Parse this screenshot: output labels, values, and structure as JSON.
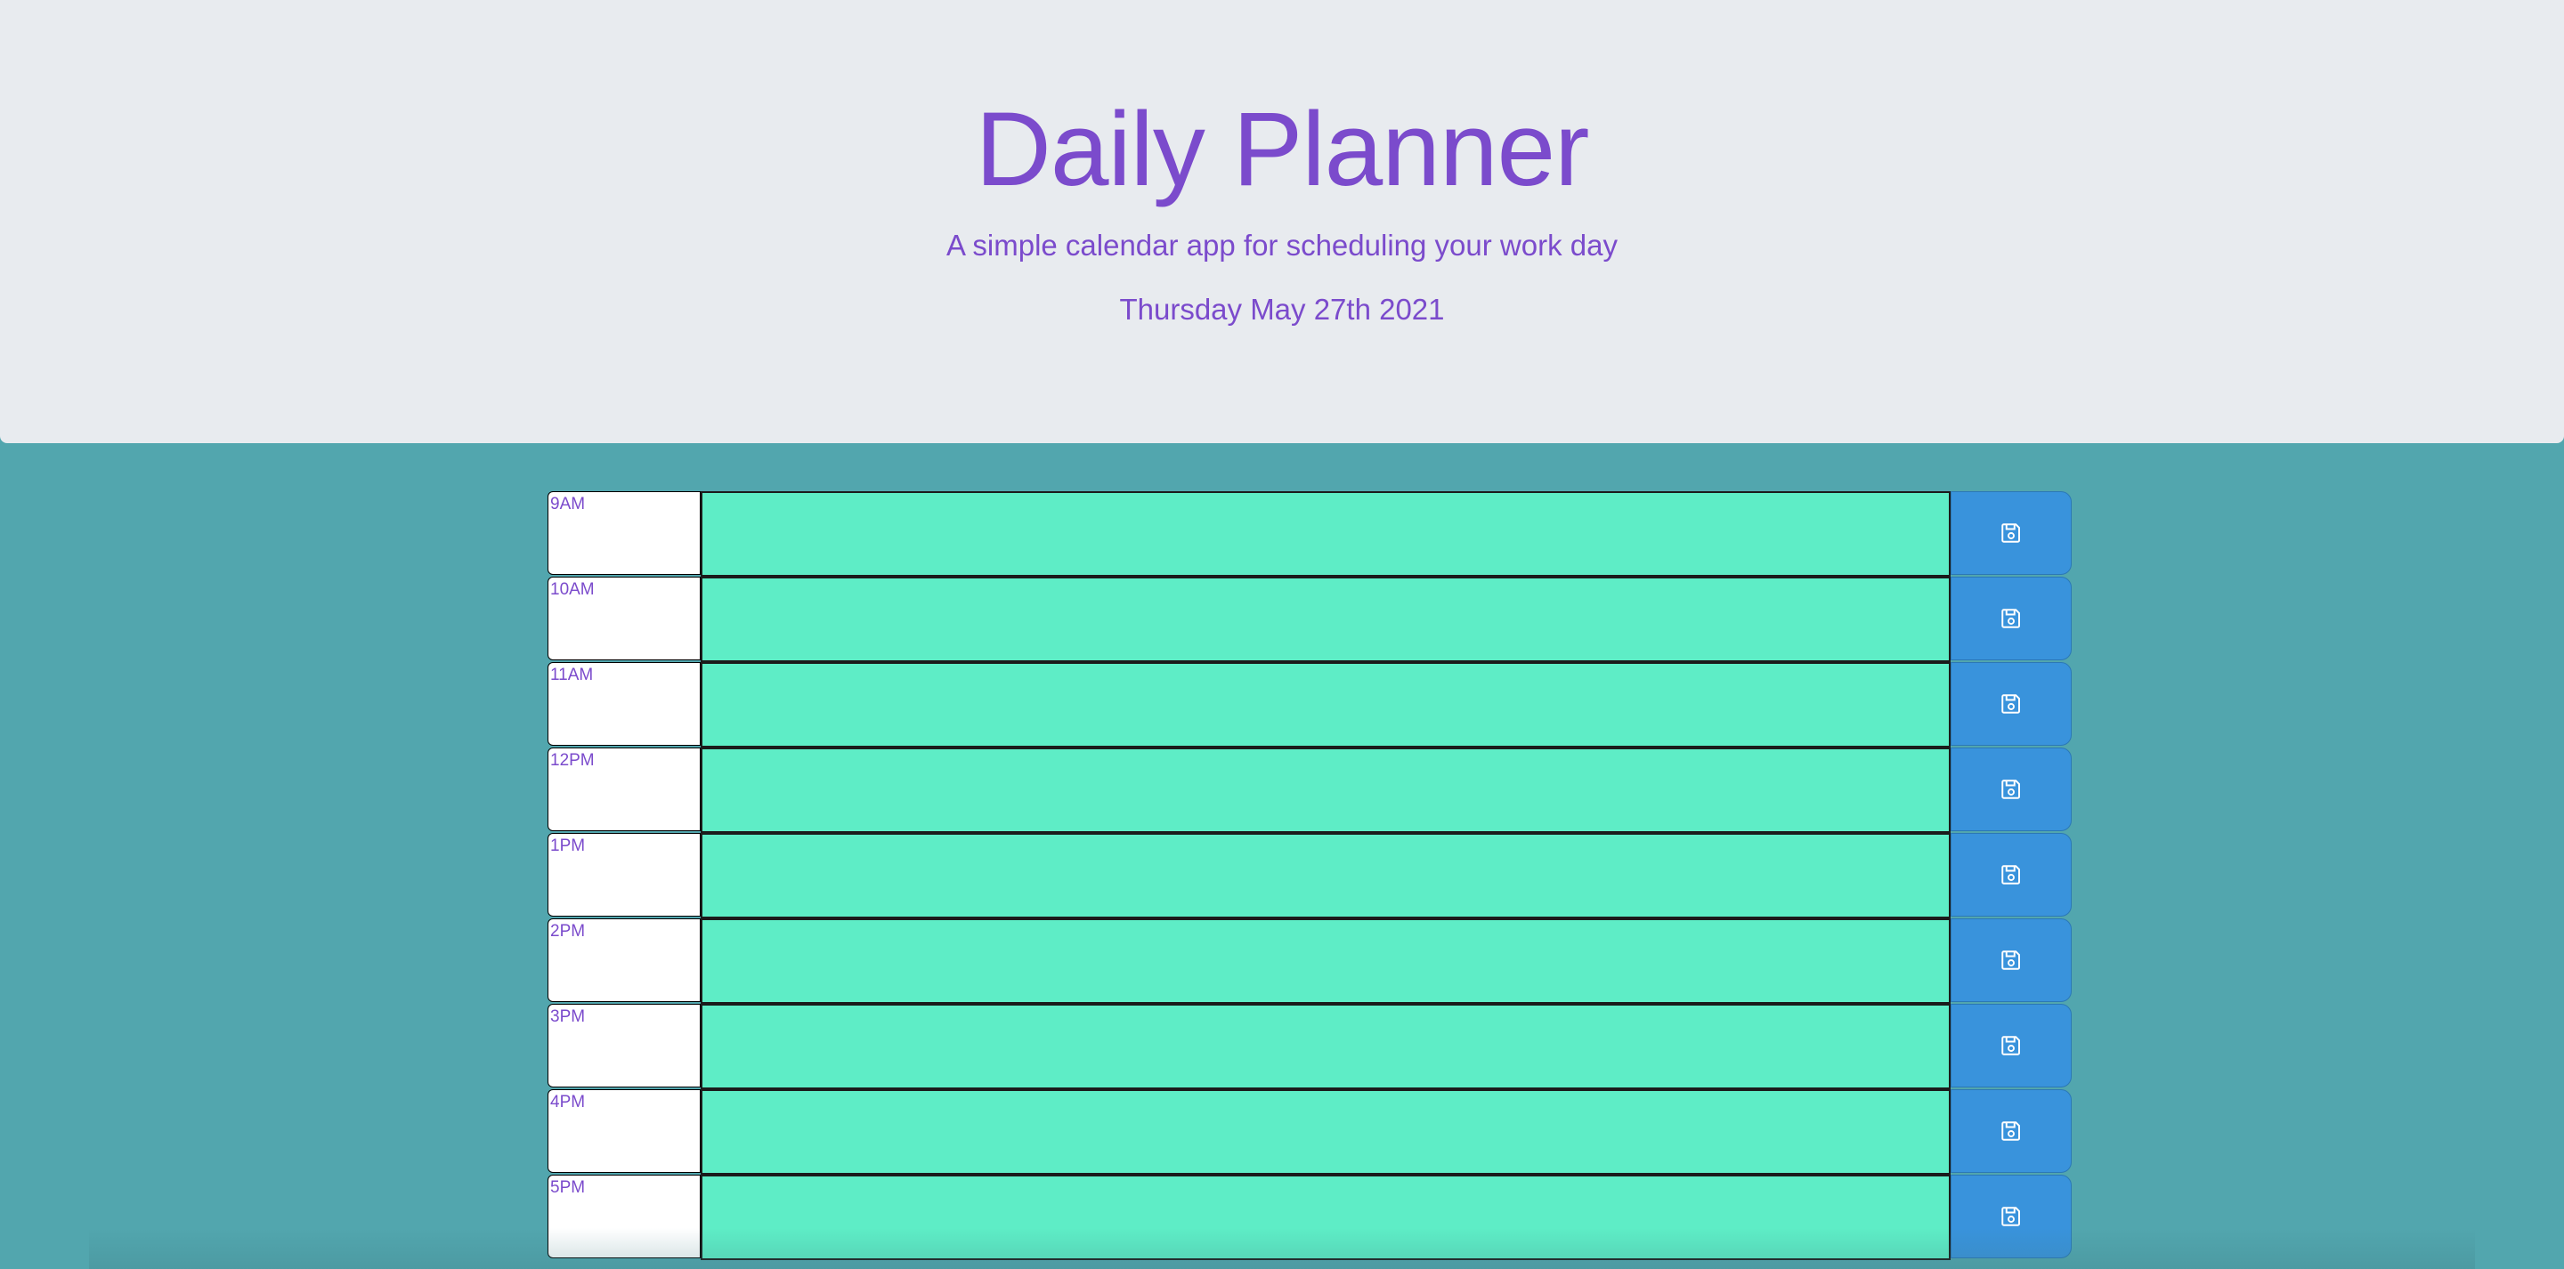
{
  "header": {
    "title": "Daily Planner",
    "subtitle": "A simple calendar app for scheduling your work day",
    "current_day": "Thursday May 27th 2021"
  },
  "colors": {
    "header_bg": "#e8ebef",
    "page_bg": "#52a6ae",
    "accent_text": "#7b4bcc",
    "future_block": "#5eedc6",
    "save_button": "#3993dc"
  },
  "planner": {
    "rows": [
      {
        "hour": "9AM",
        "description": "",
        "save_icon": "save-icon"
      },
      {
        "hour": "10AM",
        "description": "",
        "save_icon": "save-icon"
      },
      {
        "hour": "11AM",
        "description": "",
        "save_icon": "save-icon"
      },
      {
        "hour": "12PM",
        "description": "",
        "save_icon": "save-icon"
      },
      {
        "hour": "1PM",
        "description": "",
        "save_icon": "save-icon"
      },
      {
        "hour": "2PM",
        "description": "",
        "save_icon": "save-icon"
      },
      {
        "hour": "3PM",
        "description": "",
        "save_icon": "save-icon"
      },
      {
        "hour": "4PM",
        "description": "",
        "save_icon": "save-icon"
      },
      {
        "hour": "5PM",
        "description": "",
        "save_icon": "save-icon"
      }
    ]
  }
}
